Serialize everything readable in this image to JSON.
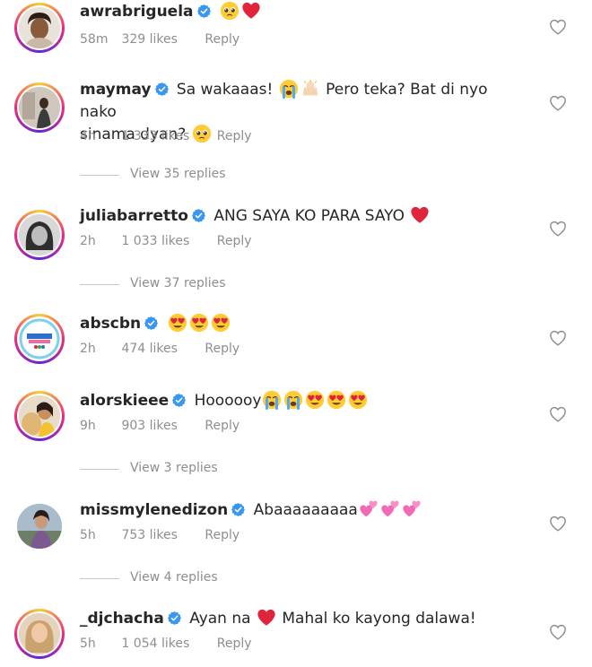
{
  "comments": [
    {
      "username": "awrabriguela",
      "text": "",
      "emojis": [
        "pleading",
        "red-heart"
      ],
      "time": "58m",
      "likes": "329 likes",
      "reply": "Reply"
    },
    {
      "username": "maymay",
      "text": "Sa wakaaas!",
      "text2": "Pero teka? Bat di nyo nako",
      "text3": "sinama dyan?",
      "emojis": [
        "crying",
        "raised-hands"
      ],
      "emoji_end": "pleading",
      "time": "4h",
      "likes": "1 333 likes",
      "reply": "Reply",
      "view_replies": "View 35 replies"
    },
    {
      "username": "juliabarretto",
      "text": "ANG SAYA KO PARA SAYO",
      "emojis": [
        "red-heart"
      ],
      "time": "2h",
      "likes": "1 033 likes",
      "reply": "Reply",
      "view_replies": "View 37 replies"
    },
    {
      "username": "abscbn",
      "text": "",
      "emojis": [
        "heart-eyes",
        "heart-eyes",
        "heart-eyes"
      ],
      "time": "2h",
      "likes": "474 likes",
      "reply": "Reply"
    },
    {
      "username": "alorskieee",
      "text": "Hoooooy",
      "emojis": [
        "crying",
        "crying",
        "heart-eyes",
        "heart-eyes",
        "heart-eyes"
      ],
      "time": "9h",
      "likes": "903 likes",
      "reply": "Reply",
      "view_replies": "View 3 replies"
    },
    {
      "username": "missmylenedizon",
      "text": "Abaaaaaaaaa",
      "emojis": [
        "two-hearts",
        "two-hearts",
        "two-hearts"
      ],
      "time": "5h",
      "likes": "753 likes",
      "reply": "Reply",
      "view_replies": "View 4 replies"
    },
    {
      "username": "_djchacha",
      "text": "Ayan na",
      "text2": "Mahal ko kayong dalawa!",
      "emojis": [
        "red-heart"
      ],
      "time": "5h",
      "likes": "1 054 likes",
      "reply": "Reply"
    }
  ],
  "colors": {
    "verified": "#3897f0",
    "muted": "#8e8e8e",
    "text": "#262626"
  },
  "icons": {
    "like": "heart-outline-icon",
    "verified": "verified-badge-icon"
  }
}
